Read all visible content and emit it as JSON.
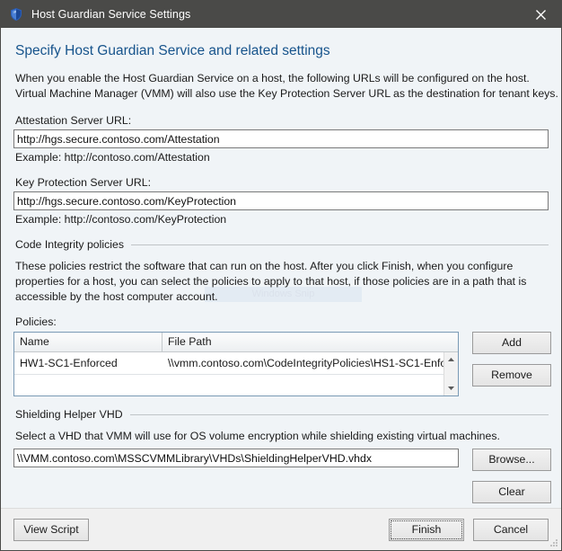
{
  "window": {
    "title": "Host Guardian Service Settings",
    "icon": "shield-icon",
    "close_label": "✕",
    "accent_blue": "#17548c",
    "titlebar_bg": "#4a4a48",
    "body_bg": "#f0f4f7",
    "footer_bg": "#f0f0f0"
  },
  "page": {
    "heading": "Specify Host Guardian Service and related settings",
    "intro_line1": "When you enable the Host Guardian Service on a host, the following URLs will be configured on the host.",
    "intro_line2": "Virtual Machine Manager (VMM) will also use the Key Protection Server URL as the destination for tenant keys."
  },
  "attestation": {
    "label": "Attestation Server URL:",
    "value": "http://hgs.secure.contoso.com/Attestation",
    "placeholder": "",
    "hint": "Example: http://contoso.com/Attestation"
  },
  "key_protection": {
    "label": "Key Protection Server URL:",
    "value": "http://hgs.secure.contoso.com/KeyProtection",
    "placeholder": "",
    "hint": "Example: http://contoso.com/KeyProtection"
  },
  "code_integrity": {
    "group_label": "Code Integrity policies",
    "para_line1": "These policies restrict the software that can run on the host. After you click Finish, when you configure",
    "para_line2": "properties for a host, you can select the policies to apply to that host, if those policies are in a path that is",
    "para_line3": "accessible by the host computer account.",
    "watermark": "Windows Snip",
    "policies_label": "Policies:",
    "columns": [
      "Name",
      "File Path"
    ],
    "rows": [
      {
        "name": "HW1-SC1-Enforced",
        "path": "\\\\vmm.contoso.com\\CodeIntegrityPolicies\\HS1-SC1-Enfo..."
      }
    ],
    "add_label": "Add",
    "remove_label": "Remove",
    "scroll_up": "scroll-up-arrow",
    "scroll_down": "scroll-down-arrow"
  },
  "shielding": {
    "group_label": "Shielding Helper VHD",
    "description": "Select a VHD that VMM will use for OS volume encryption while shielding existing virtual machines.",
    "value": "\\\\VMM.contoso.com\\MSSCVMMLibrary\\VHDs\\ShieldingHelperVHD.vhdx",
    "placeholder": "",
    "browse_label": "Browse...",
    "clear_label": "Clear"
  },
  "footer": {
    "view_script_label": "View Script",
    "finish_label": "Finish",
    "cancel_label": "Cancel"
  }
}
